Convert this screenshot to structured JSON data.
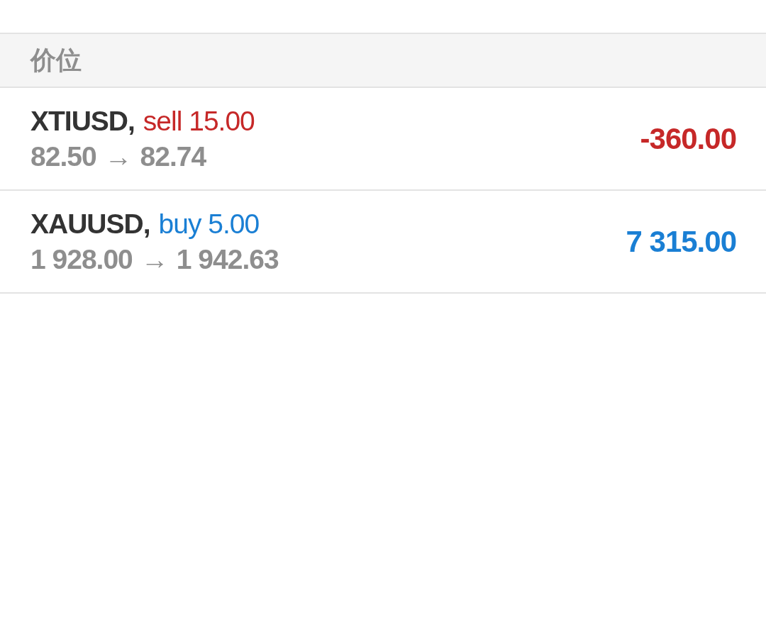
{
  "section_header": {
    "label": "价位"
  },
  "positions": [
    {
      "symbol": "XTIUSD,",
      "kind": "sell",
      "order": "sell 15.00",
      "open_price": "82.50",
      "arrow": "→",
      "current_price": "82.74",
      "profit": "-360.00"
    },
    {
      "symbol": "XAUUSD,",
      "kind": "buy",
      "order": "buy 5.00",
      "open_price": "1 928.00",
      "arrow": "→",
      "current_price": "1 942.63",
      "profit": "7 315.00"
    }
  ]
}
